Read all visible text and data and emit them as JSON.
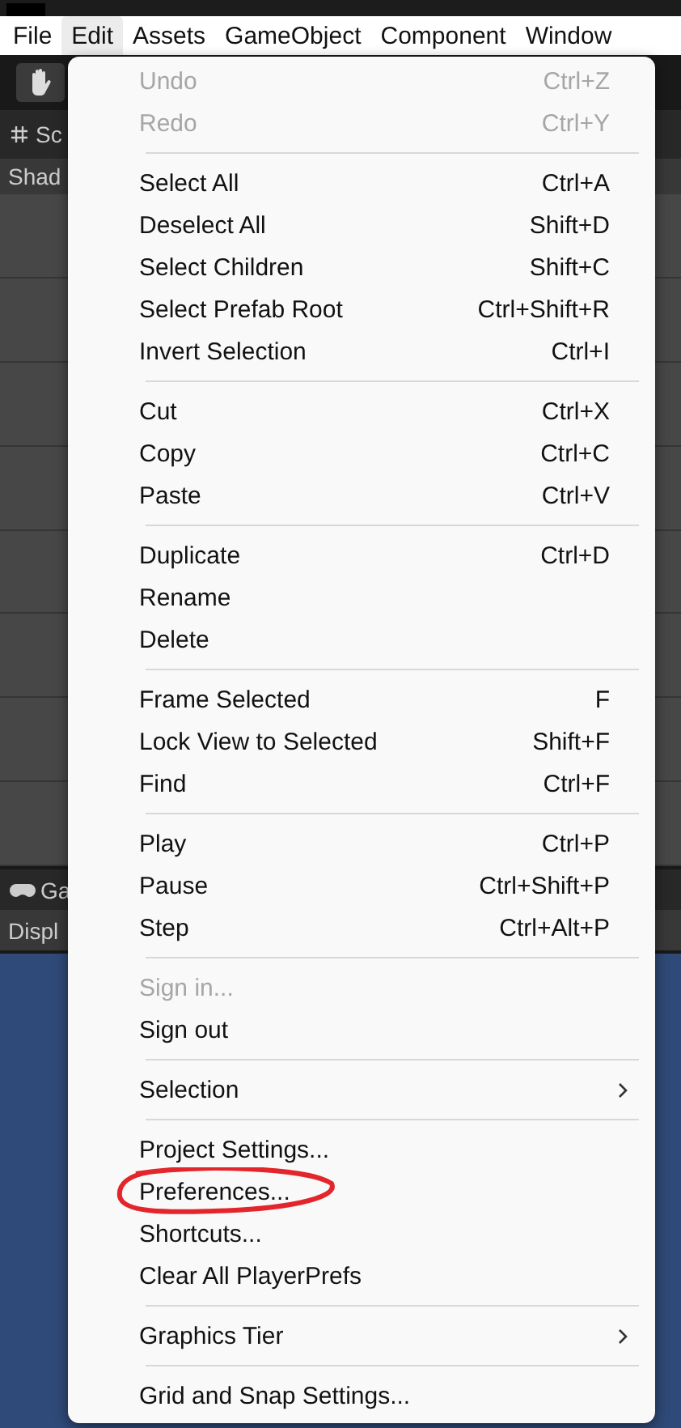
{
  "menu_bar": [
    {
      "label": "File",
      "selected": false
    },
    {
      "label": "Edit",
      "selected": true
    },
    {
      "label": "Assets",
      "selected": false
    },
    {
      "label": "GameObject",
      "selected": false
    },
    {
      "label": "Component",
      "selected": false
    },
    {
      "label": "Window",
      "selected": false
    }
  ],
  "scene_panel": {
    "tab": "Sc",
    "toolbar": "Shad"
  },
  "game_panel": {
    "tab": "Ga",
    "toolbar": "Displ"
  },
  "edit_menu": [
    {
      "items": [
        {
          "label": "Undo",
          "shortcut": "Ctrl+Z",
          "disabled": true
        },
        {
          "label": "Redo",
          "shortcut": "Ctrl+Y",
          "disabled": true
        }
      ]
    },
    {
      "items": [
        {
          "label": "Select All",
          "shortcut": "Ctrl+A",
          "disabled": false
        },
        {
          "label": "Deselect All",
          "shortcut": "Shift+D",
          "disabled": false
        },
        {
          "label": "Select Children",
          "shortcut": "Shift+C",
          "disabled": false
        },
        {
          "label": "Select Prefab Root",
          "shortcut": "Ctrl+Shift+R",
          "disabled": false
        },
        {
          "label": "Invert Selection",
          "shortcut": "Ctrl+I",
          "disabled": false
        }
      ]
    },
    {
      "items": [
        {
          "label": "Cut",
          "shortcut": "Ctrl+X",
          "disabled": false
        },
        {
          "label": "Copy",
          "shortcut": "Ctrl+C",
          "disabled": false
        },
        {
          "label": "Paste",
          "shortcut": "Ctrl+V",
          "disabled": false
        }
      ]
    },
    {
      "items": [
        {
          "label": "Duplicate",
          "shortcut": "Ctrl+D",
          "disabled": false
        },
        {
          "label": "Rename",
          "disabled": false
        },
        {
          "label": "Delete",
          "disabled": false
        }
      ]
    },
    {
      "items": [
        {
          "label": "Frame Selected",
          "shortcut": "F",
          "disabled": false
        },
        {
          "label": "Lock View to Selected",
          "shortcut": "Shift+F",
          "disabled": false
        },
        {
          "label": "Find",
          "shortcut": "Ctrl+F",
          "disabled": false
        }
      ]
    },
    {
      "items": [
        {
          "label": "Play",
          "shortcut": "Ctrl+P",
          "disabled": false
        },
        {
          "label": "Pause",
          "shortcut": "Ctrl+Shift+P",
          "disabled": false
        },
        {
          "label": "Step",
          "shortcut": "Ctrl+Alt+P",
          "disabled": false
        }
      ]
    },
    {
      "items": [
        {
          "label": "Sign in...",
          "disabled": true
        },
        {
          "label": "Sign out",
          "disabled": false
        }
      ]
    },
    {
      "items": [
        {
          "label": "Selection",
          "disabled": false,
          "submenu": true
        }
      ]
    },
    {
      "items": [
        {
          "label": "Project Settings...",
          "disabled": false
        },
        {
          "label": "Preferences...",
          "disabled": false,
          "highlighted": true
        },
        {
          "label": "Shortcuts...",
          "disabled": false
        },
        {
          "label": "Clear All PlayerPrefs",
          "disabled": false
        }
      ]
    },
    {
      "items": [
        {
          "label": "Graphics Tier",
          "disabled": false,
          "submenu": true
        }
      ]
    },
    {
      "items": [
        {
          "label": "Grid and Snap Settings...",
          "disabled": false
        }
      ]
    }
  ]
}
